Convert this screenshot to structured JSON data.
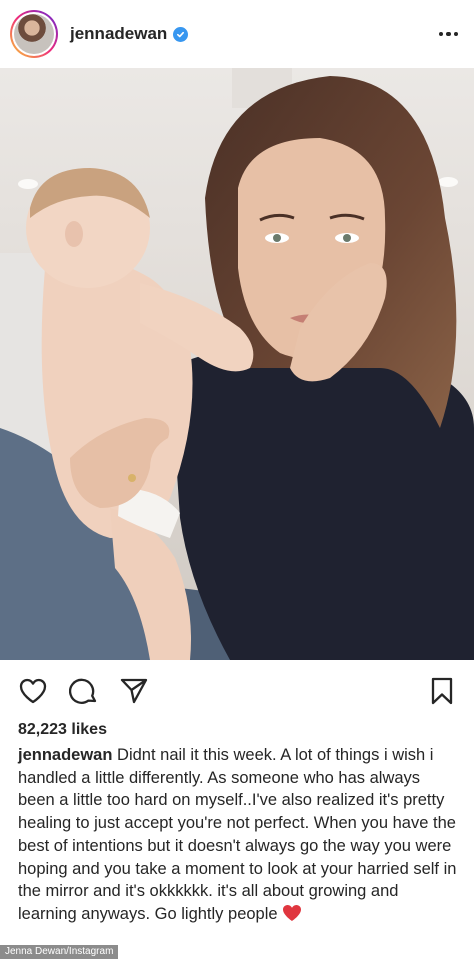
{
  "post": {
    "username": "jennadewan",
    "verified": true,
    "likes": "82,223 likes",
    "caption": "Didnt nail it this week. A lot of things i wish i handled a little differently. As someone who has always been a little too hard on myself..I've also realized it's pretty healing to just accept you're not perfect. When you have the best of intentions but it doesn't always go the way you were hoping and you take a moment to look at your harried self in the mirror and it's okkkkkk. it's all about growing and learning anyways. Go lightly people",
    "caption_emoji": "heart-emoji"
  },
  "icons": {
    "more": "more-options-icon",
    "like": "heart-icon",
    "comment": "comment-icon",
    "share": "paper-plane-icon",
    "save": "bookmark-icon"
  },
  "credit": "Jenna Dewan/Instagram",
  "colors": {
    "text": "#262626",
    "verified": "#3897f0",
    "heart_emoji": "#e0363f",
    "credit_bg": "#8c8c8c"
  }
}
